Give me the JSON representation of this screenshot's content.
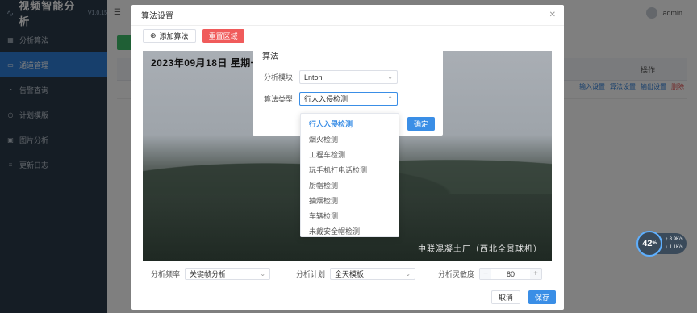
{
  "brand": {
    "title": "视频智能分析",
    "version": "V1.0.15"
  },
  "sidebar": {
    "items": [
      {
        "label": "分析算法",
        "icon": "grid-icon",
        "active": false
      },
      {
        "label": "通道管理",
        "icon": "video-icon",
        "active": true
      },
      {
        "label": "告警查询",
        "icon": "bell-icon",
        "active": false
      },
      {
        "label": "计划模版",
        "icon": "clock-icon",
        "active": false
      },
      {
        "label": "图片分析",
        "icon": "image-icon",
        "active": false
      },
      {
        "label": "更新日志",
        "icon": "log-icon",
        "active": false
      }
    ]
  },
  "topbar": {
    "user": "admin"
  },
  "main": {
    "ops_header": "操作",
    "ops": [
      "输入设置",
      "算法设置",
      "输出设置",
      "删除"
    ]
  },
  "dialog": {
    "title": "算法设置",
    "add_algorithm": "添加算法",
    "redraw_area": "重置区域",
    "video_timestamp": "2023年09月18日  星期一",
    "video_watermark": "中联混凝土厂（西北全景球机）",
    "freq_label": "分析频率",
    "freq_value": "关键帧分析",
    "plan_label": "分析计划",
    "plan_value": "全天模板",
    "sensitivity_label": "分析灵敏度",
    "sensitivity_value": "80",
    "cancel": "取消",
    "save": "保存"
  },
  "inner_dialog": {
    "title": "算法",
    "module_label": "分析模块",
    "module_value": "Lnton",
    "type_label": "算法类型",
    "type_value": "行人入侵检测",
    "confirm": "确定"
  },
  "dropdown": {
    "options": [
      "行人入侵检测",
      "烟火检测",
      "工程车检测",
      "玩手机打电话检测",
      "厨帽检测",
      "抽烟检测",
      "车辆检测",
      "未戴安全帽检测"
    ],
    "selected_index": 0
  },
  "net_widget": {
    "percent": "42",
    "unit": "%",
    "up": "8.9",
    "up_unit": "K/s",
    "down": "1.1",
    "down_unit": "K/s"
  },
  "colors": {
    "accent": "#3a8ee6",
    "sidebar_bg": "#2b3a4a",
    "active_nav": "#2f7fd8",
    "danger": "#f05b5b"
  }
}
